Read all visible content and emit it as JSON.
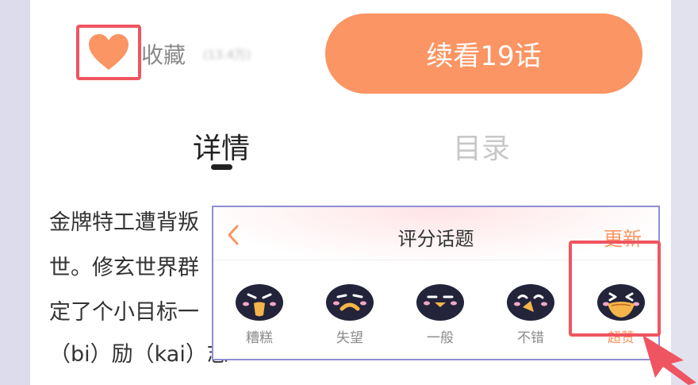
{
  "actions": {
    "favorite_label": "收藏",
    "favorite_count": "(13.4万)",
    "continue_label": "续看19话"
  },
  "tabs": [
    {
      "label": "详情",
      "active": true
    },
    {
      "label": "目录",
      "active": false
    }
  ],
  "description": {
    "lines": [
      "金牌特工遭背叛",
      "世。修玄世界群",
      "定了个小目标一",
      "（bi）励（kai）志"
    ]
  },
  "rating_popup": {
    "title": "评分话题",
    "refresh_label": "更新",
    "options": [
      {
        "label": "糟糕",
        "icon": "angry-penguin-icon"
      },
      {
        "label": "失望",
        "icon": "sad-penguin-icon"
      },
      {
        "label": "一般",
        "icon": "neutral-penguin-icon"
      },
      {
        "label": "不错",
        "icon": "happy-penguin-icon"
      },
      {
        "label": "超赞",
        "icon": "excited-penguin-icon",
        "selected": true
      }
    ]
  },
  "colors": {
    "accent": "#fb9563",
    "highlight": "#ef5560",
    "popup_border": "#8f8ed6"
  }
}
